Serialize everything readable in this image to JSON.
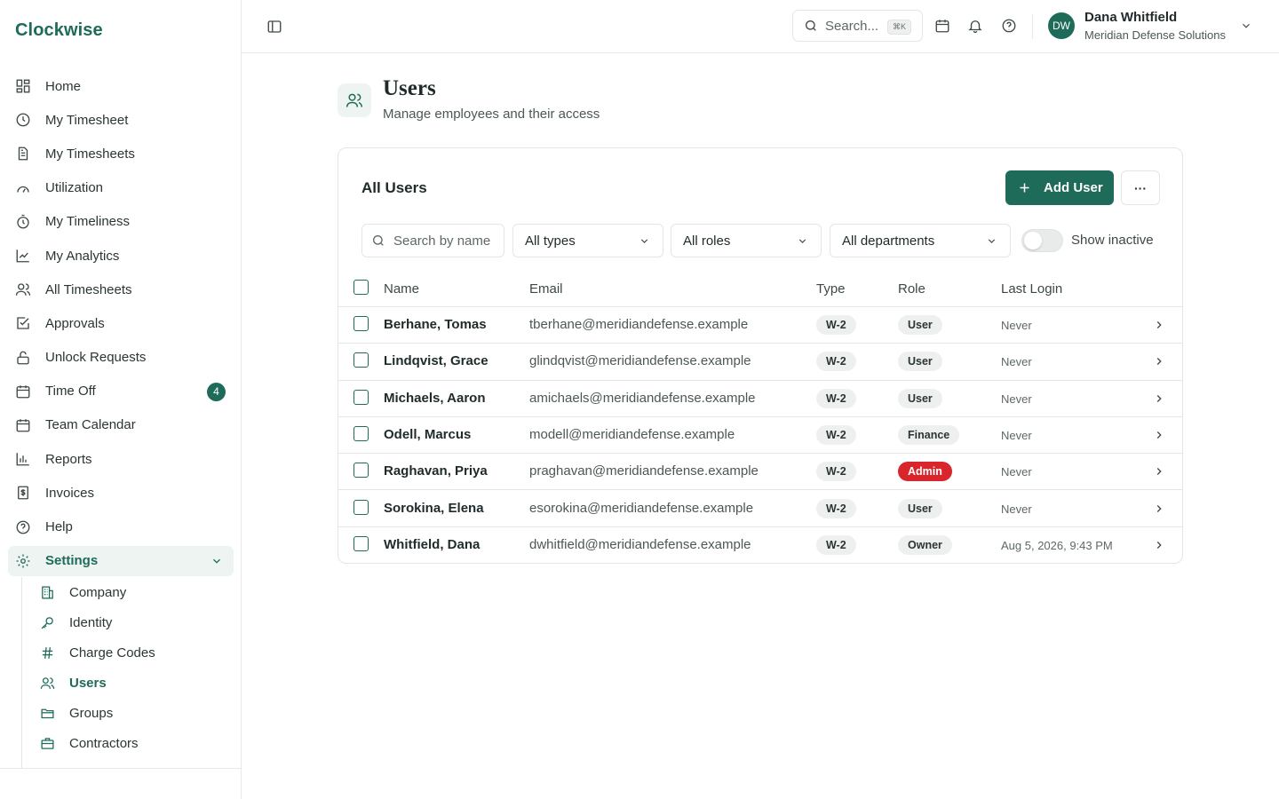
{
  "app": {
    "brand": "Clockwise"
  },
  "sidebar": {
    "items": [
      {
        "label": "Home",
        "icon": "home-grid-icon"
      },
      {
        "label": "My Timesheet",
        "icon": "clock-icon"
      },
      {
        "label": "My Timesheets",
        "icon": "document-icon"
      },
      {
        "label": "Utilization",
        "icon": "gauge-icon"
      },
      {
        "label": "My Timeliness",
        "icon": "stopwatch-icon"
      },
      {
        "label": "My Analytics",
        "icon": "line-chart-icon"
      },
      {
        "label": "All Timesheets",
        "icon": "users-icon"
      },
      {
        "label": "Approvals",
        "icon": "check-square-icon"
      },
      {
        "label": "Unlock Requests",
        "icon": "unlock-icon"
      },
      {
        "label": "Time Off",
        "icon": "calendar-icon",
        "badge": "4"
      },
      {
        "label": "Team Calendar",
        "icon": "calendar-icon"
      },
      {
        "label": "Reports",
        "icon": "bar-chart-icon"
      },
      {
        "label": "Invoices",
        "icon": "invoice-icon"
      },
      {
        "label": "Help",
        "icon": "help-icon"
      }
    ],
    "settings": {
      "label": "Settings",
      "icon": "gear-icon"
    },
    "sub_items": [
      {
        "label": "Company",
        "icon": "building-icon"
      },
      {
        "label": "Identity",
        "icon": "key-icon"
      },
      {
        "label": "Charge Codes",
        "icon": "hash-icon"
      },
      {
        "label": "Users",
        "icon": "users-icon"
      },
      {
        "label": "Groups",
        "icon": "folder-icon"
      },
      {
        "label": "Contractors",
        "icon": "briefcase-icon"
      }
    ]
  },
  "topbar": {
    "search_label": "Search...",
    "search_shortcut": "⌘K",
    "user": {
      "initials": "DW",
      "name": "Dana Whitfield",
      "org": "Meridian Defense Solutions"
    }
  },
  "page": {
    "title": "Users",
    "subtitle": "Manage employees and their access"
  },
  "card": {
    "title": "All Users",
    "add_label": "Add User",
    "more_label": "···",
    "search_placeholder": "Search by name",
    "filters": {
      "type": "All types",
      "role": "All roles",
      "department": "All departments"
    },
    "show_inactive_label": "Show inactive",
    "show_inactive": false
  },
  "table": {
    "headers": {
      "name": "Name",
      "email": "Email",
      "type": "Type",
      "role": "Role",
      "last_login": "Last Login"
    },
    "rows": [
      {
        "name": "Berhane, Tomas",
        "email": "tberhane@meridiandefense.example",
        "type": "W-2",
        "role": "User",
        "last_login": "Never"
      },
      {
        "name": "Lindqvist, Grace",
        "email": "glindqvist@meridiandefense.example",
        "type": "W-2",
        "role": "User",
        "last_login": "Never"
      },
      {
        "name": "Michaels, Aaron",
        "email": "amichaels@meridiandefense.example",
        "type": "W-2",
        "role": "User",
        "last_login": "Never"
      },
      {
        "name": "Odell, Marcus",
        "email": "modell@meridiandefense.example",
        "type": "W-2",
        "role": "Finance",
        "last_login": "Never"
      },
      {
        "name": "Raghavan, Priya",
        "email": "praghavan@meridiandefense.example",
        "type": "W-2",
        "role": "Admin",
        "last_login": "Never"
      },
      {
        "name": "Sorokina, Elena",
        "email": "esorokina@meridiandefense.example",
        "type": "W-2",
        "role": "User",
        "last_login": "Never"
      },
      {
        "name": "Whitfield, Dana",
        "email": "dwhitfield@meridiandefense.example",
        "type": "W-2",
        "role": "Owner",
        "last_login": "Aug 5, 2026, 9:43 PM"
      }
    ]
  },
  "colors": {
    "brand": "#1e6b5a",
    "admin": "#d8262c",
    "active_bg": "#eef4f2"
  }
}
